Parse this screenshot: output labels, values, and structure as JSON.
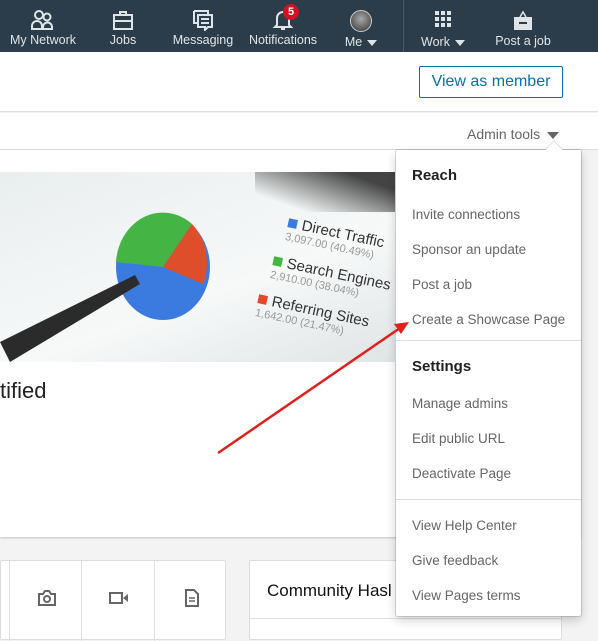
{
  "nav": {
    "items": [
      {
        "label": "My Network",
        "icon": "people-icon"
      },
      {
        "label": "Jobs",
        "icon": "briefcase-icon"
      },
      {
        "label": "Messaging",
        "icon": "messaging-icon"
      },
      {
        "label": "Notifications",
        "icon": "bell-icon",
        "badge": "5"
      },
      {
        "label": "Me",
        "icon": "avatar"
      },
      {
        "label": "Work",
        "icon": "grid-icon"
      },
      {
        "label": "Post a job",
        "icon": "post-job-icon"
      }
    ]
  },
  "header": {
    "view_as_member": "View as member"
  },
  "admin_bar": {
    "label": "Admin tools"
  },
  "hero": {
    "legend": [
      {
        "label": "Direct Traffic",
        "value": "3,097.00 (40.49%)",
        "color": "#3b7be0"
      },
      {
        "label": "Search Engines",
        "value": "2,910.00 (38.04%)",
        "color": "#3fb83f"
      },
      {
        "label": "Referring Sites",
        "value": "1,642.00 (21.47%)",
        "color": "#e0492b"
      }
    ]
  },
  "card": {
    "title_fragment": "tified"
  },
  "composer": {
    "icons": [
      "camera-icon",
      "video-icon",
      "document-icon"
    ]
  },
  "community": {
    "title": "Community Hasl"
  },
  "dropdown": {
    "reach": {
      "title": "Reach",
      "items": [
        "Invite connections",
        "Sponsor an update",
        "Post a job",
        "Create a Showcase Page"
      ]
    },
    "settings": {
      "title": "Settings",
      "items": [
        "Manage admins",
        "Edit public URL",
        "Deactivate Page"
      ]
    },
    "help": {
      "items": [
        "View Help Center",
        "Give feedback",
        "View Pages terms"
      ]
    }
  },
  "colors": {
    "nav_bg": "#2b3d4a",
    "accent": "#0073b1",
    "annotation_arrow": "#e0201b"
  }
}
